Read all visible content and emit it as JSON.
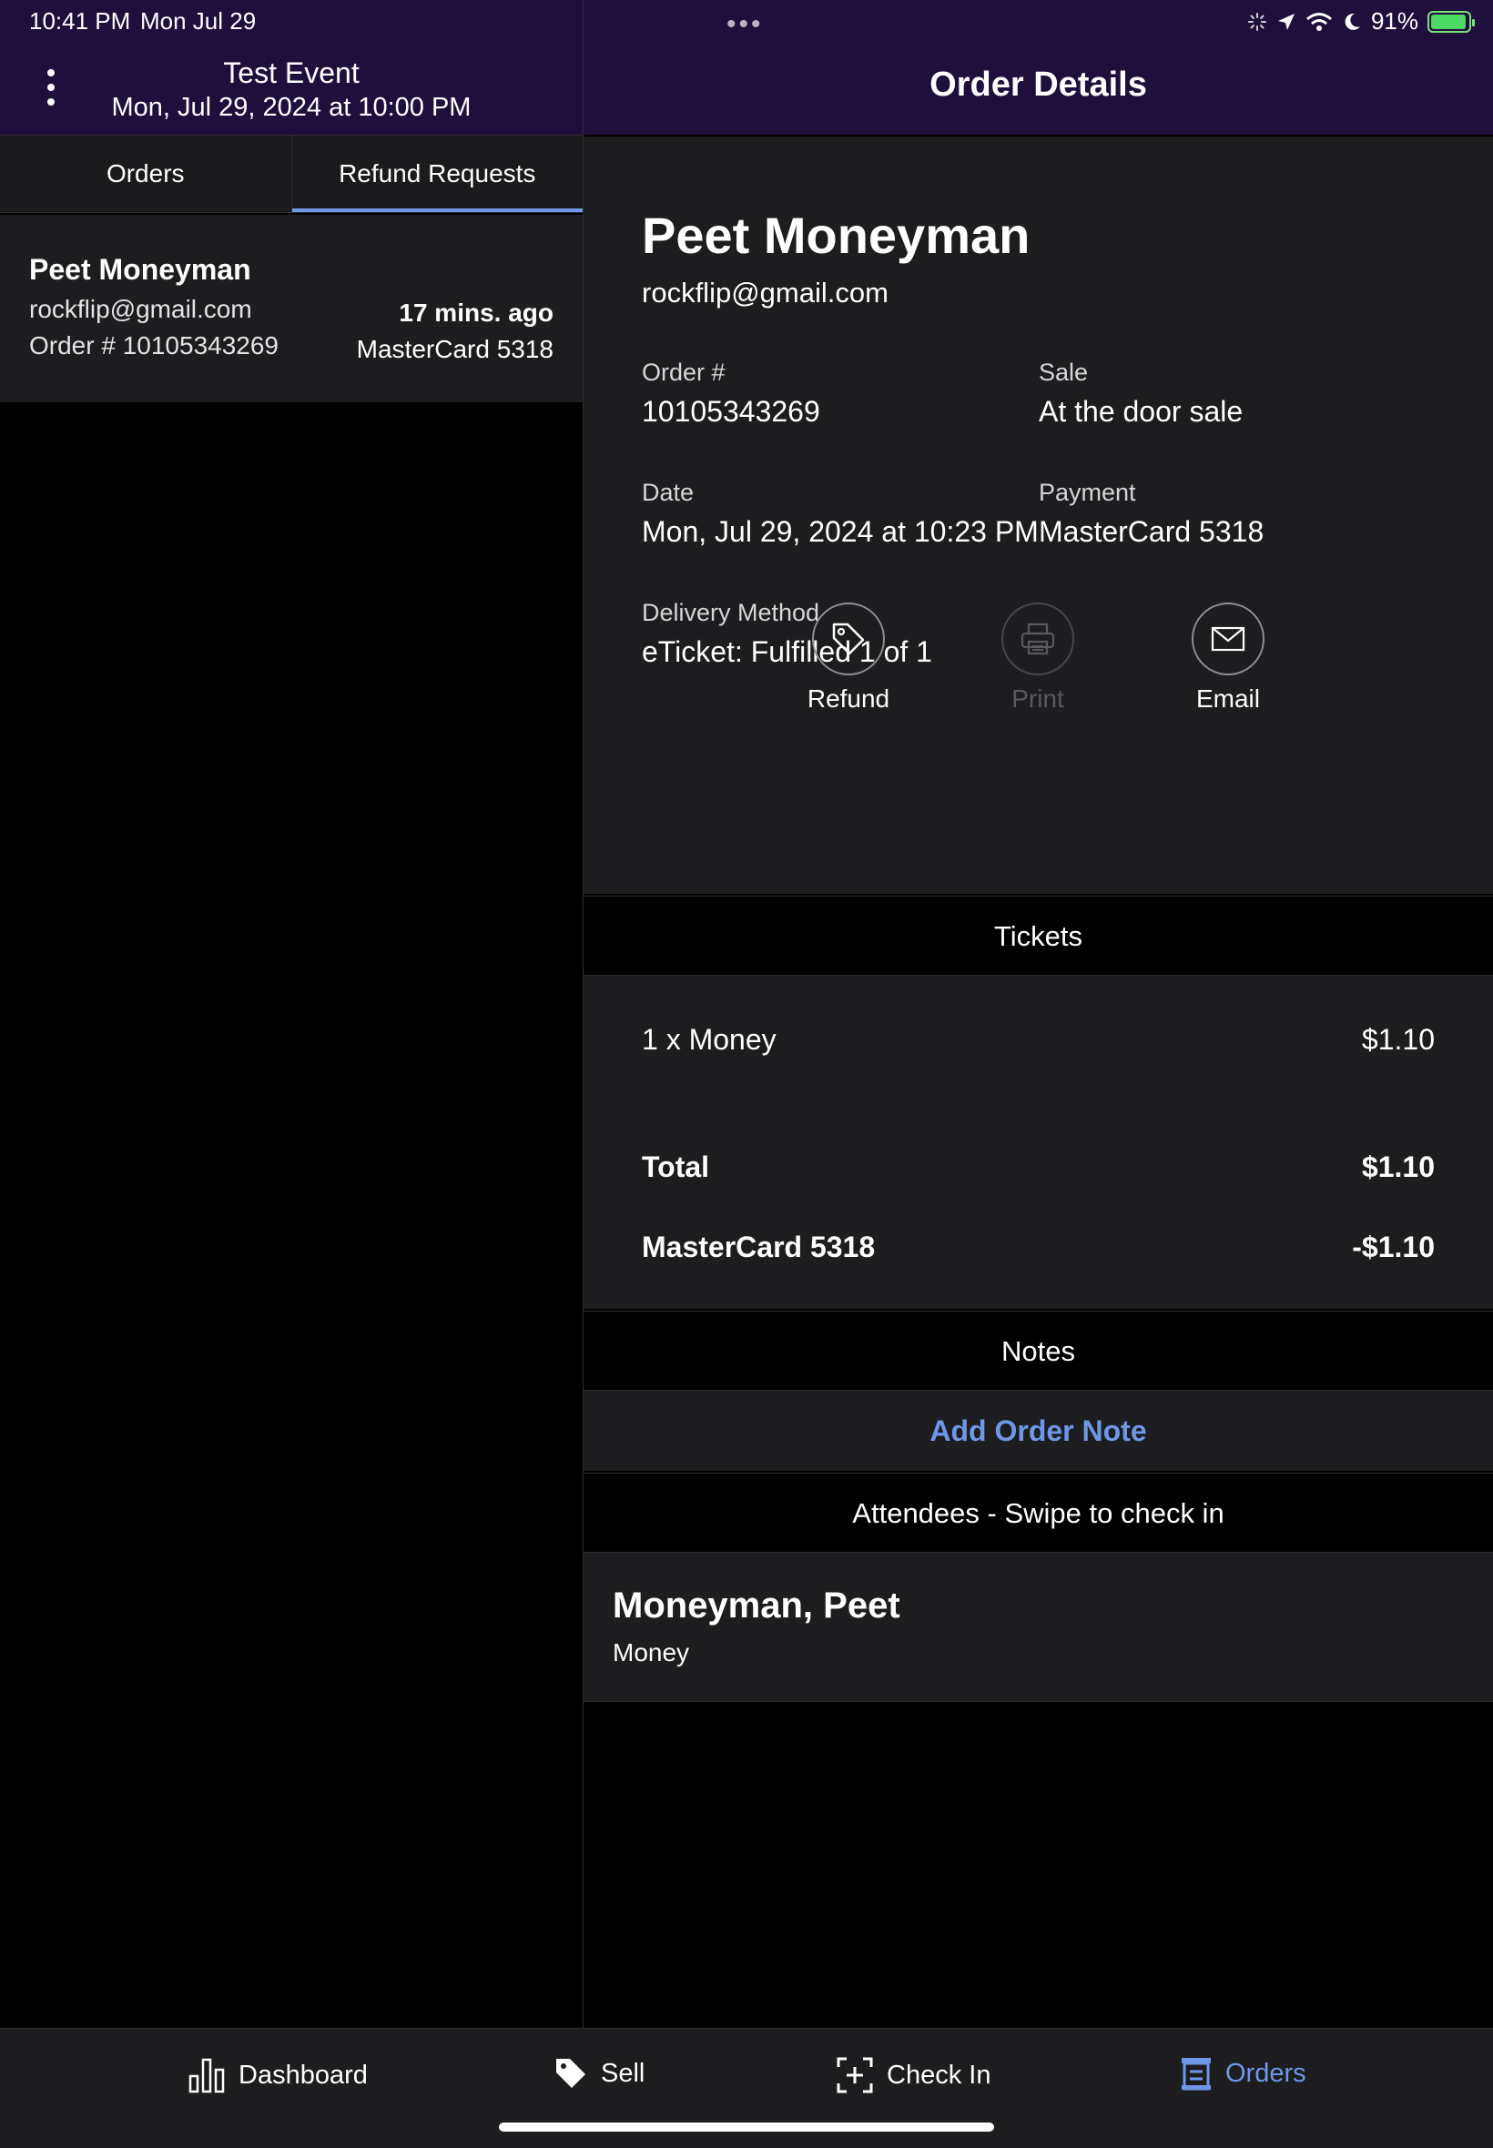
{
  "status_bar": {
    "time": "10:41 PM",
    "date": "Mon Jul 29",
    "battery": "91%"
  },
  "left_header": {
    "event_title": "Test Event",
    "event_date": "Mon, Jul 29, 2024 at 10:00 PM"
  },
  "right_header": {
    "title": "Order Details"
  },
  "tabs": [
    {
      "label": "Orders",
      "active": false
    },
    {
      "label": "Refund Requests",
      "active": true
    }
  ],
  "order_list": [
    {
      "name": "Peet Moneyman",
      "email": "rockflip@gmail.com",
      "order": "Order # 10105343269",
      "time_ago": "17 mins. ago",
      "payment": "MasterCard 5318"
    }
  ],
  "order_details": {
    "customer_name": "Peet Moneyman",
    "customer_email": "rockflip@gmail.com",
    "fields": {
      "order_label": "Order #",
      "order_value": "10105343269",
      "sale_label": "Sale",
      "sale_value": "At the door sale",
      "date_label": "Date",
      "date_value": "Mon, Jul 29, 2024 at 10:23 PM",
      "payment_label": "Payment",
      "payment_value": "MasterCard 5318",
      "delivery_label": "Delivery Method",
      "delivery_value": "eTicket: Fulfilled 1 of 1"
    },
    "actions": {
      "refund": "Refund",
      "print": "Print",
      "email": "Email"
    }
  },
  "tickets": {
    "header": "Tickets",
    "item": "1 x Money",
    "item_price": "$1.10",
    "total_label": "Total",
    "total_value": "$1.10",
    "payment_label": "MasterCard 5318",
    "payment_value": "-$1.10"
  },
  "notes": {
    "header": "Notes",
    "add_label": "Add Order Note"
  },
  "attendees": {
    "header": "Attendees - Swipe to check in",
    "list": [
      {
        "name": "Moneyman, Peet",
        "ticket_type": "Money"
      }
    ]
  },
  "bottom_nav": [
    {
      "label": "Dashboard",
      "icon": "bar-chart-icon",
      "active": false
    },
    {
      "label": "Sell",
      "icon": "tag-icon",
      "active": false
    },
    {
      "label": "Check In",
      "icon": "scan-plus-icon",
      "active": false
    },
    {
      "label": "Orders",
      "icon": "receipt-icon",
      "active": true
    }
  ],
  "colors": {
    "header_bg": "#1f0f3d",
    "accent": "#6f97e8",
    "panel_bg": "#1d1d1f",
    "battery_green": "#4cd964"
  }
}
